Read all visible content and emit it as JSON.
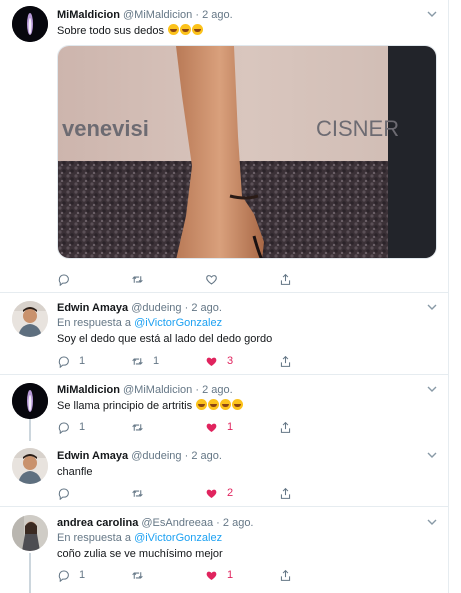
{
  "tweets": [
    {
      "name": "MiMaldicion",
      "handle": "@MiMaldicion",
      "dot": "·",
      "time": "2 ago.",
      "text": "Sobre todo sus dedos",
      "emoji": [
        "rolling-on-floor-laughing",
        "rolling-on-floor-laughing",
        "rolling-on-floor-laughing"
      ],
      "media": {
        "banner_left": "venevisi",
        "banner_right": "CISNER"
      },
      "actions": {
        "reply": "",
        "retweet": "",
        "like": ""
      }
    },
    {
      "name": "Edwin Amaya",
      "handle": "@dudeing",
      "dot": "·",
      "time": "2 ago.",
      "reply_prefix": "En respuesta a",
      "reply_to": "@iVictorGonzalez",
      "text": "Soy el dedo que está al lado del dedo gordo",
      "actions": {
        "reply": "1",
        "retweet": "1",
        "like": "3"
      }
    },
    {
      "name": "MiMaldicion",
      "handle": "@MiMaldicion",
      "dot": "·",
      "time": "2 ago.",
      "text": "Se llama principio de artritis",
      "emoji": [
        "rolling-on-floor-laughing",
        "rolling-on-floor-laughing",
        "rolling-on-floor-laughing",
        "rolling-on-floor-laughing"
      ],
      "actions": {
        "reply": "1",
        "retweet": "",
        "like": "1"
      }
    },
    {
      "name": "Edwin Amaya",
      "handle": "@dudeing",
      "dot": "·",
      "time": "2 ago.",
      "text": "chanfle",
      "actions": {
        "reply": "",
        "retweet": "",
        "like": "2"
      }
    },
    {
      "name": "andrea carolina",
      "handle": "@EsAndreeaa",
      "dot": "·",
      "time": "2 ago.",
      "reply_prefix": "En respuesta a",
      "reply_to": "@iVictorGonzalez",
      "text": "coño zulia se ve muchísimo mejor",
      "actions": {
        "reply": "1",
        "retweet": "",
        "like": "1"
      }
    }
  ],
  "colors": {
    "accent": "#1da1f2",
    "like": "#e0245e",
    "muted": "#657786",
    "border": "#e6ecf0"
  }
}
